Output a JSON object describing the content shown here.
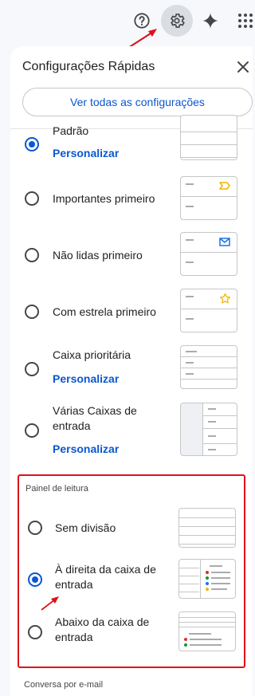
{
  "topbar": {
    "icons": [
      "help-icon",
      "settings-icon",
      "gemini-icon",
      "apps-icon"
    ]
  },
  "panel": {
    "title": "Configurações Rápidas",
    "see_all_label": "Ver todas as configurações"
  },
  "inbox_type": {
    "options": [
      {
        "label": "Padrão",
        "selected": true,
        "link": "Personalizar"
      },
      {
        "label": "Importantes primeiro",
        "selected": false
      },
      {
        "label": "Não lidas primeiro",
        "selected": false
      },
      {
        "label": "Com estrela primeiro",
        "selected": false
      },
      {
        "label": "Caixa prioritária",
        "selected": false,
        "link": "Personalizar"
      },
      {
        "label": "Várias Caixas de entrada",
        "selected": false,
        "link": "Personalizar"
      }
    ]
  },
  "reading_pane": {
    "title": "Painel de leitura",
    "options": [
      {
        "label": "Sem divisão",
        "selected": false
      },
      {
        "label": "À direita da caixa de entrada",
        "selected": true
      },
      {
        "label": "Abaixo da caixa de entrada",
        "selected": false
      }
    ]
  },
  "email_thread": {
    "title": "Conversa por e-mail"
  },
  "colors": {
    "accent": "#0b57d0",
    "highlight_red": "#e0101a",
    "important_yellow": "#f4b400",
    "envelope_blue": "#1a73e8"
  }
}
